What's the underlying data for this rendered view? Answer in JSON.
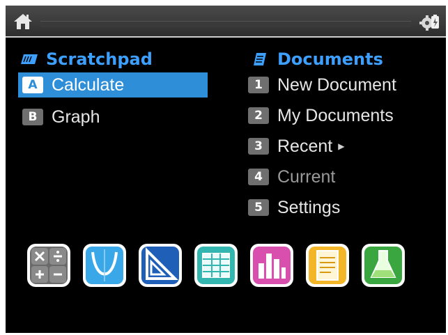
{
  "scratchpad": {
    "title": "Scratchpad",
    "items": [
      {
        "key": "A",
        "label": "Calculate",
        "selected": true
      },
      {
        "key": "B",
        "label": "Graph",
        "selected": false
      }
    ]
  },
  "documents": {
    "title": "Documents",
    "items": [
      {
        "key": "1",
        "label": "New Document"
      },
      {
        "key": "2",
        "label": "My Documents"
      },
      {
        "key": "3",
        "label": "Recent"
      },
      {
        "key": "4",
        "label": "Current"
      },
      {
        "key": "5",
        "label": "Settings"
      }
    ]
  },
  "icons": {
    "topbar": [
      "home-icon",
      "settings-icon"
    ],
    "apps": [
      "calculator-app-icon",
      "graphs-app-icon",
      "geometry-app-icon",
      "lists-spreadsheet-app-icon",
      "data-statistics-app-icon",
      "notes-app-icon",
      "vernier-dataquest-app-icon"
    ]
  },
  "colors": {
    "selected": "#2e8fd8",
    "header": "#3da0ff",
    "background": "#000000"
  }
}
